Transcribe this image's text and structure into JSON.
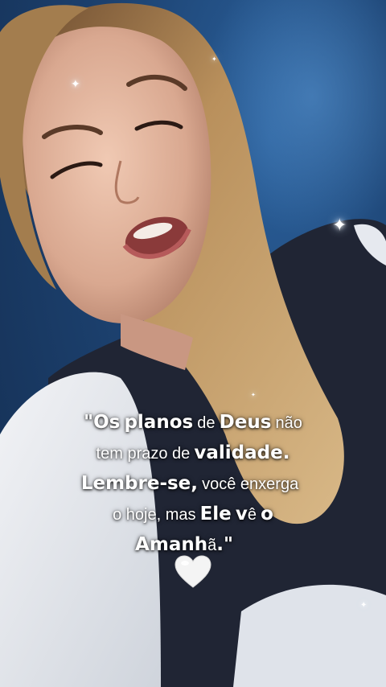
{
  "quote": {
    "line1": {
      "w1": "\"Os",
      "w2": "planos",
      "w3": "de",
      "w4": "Deus",
      "w5": "não"
    },
    "line2": {
      "w1": "tem prazo de",
      "w2": "validade."
    },
    "line3": {
      "w1": "Lembre-se,",
      "w2": "você enxerga"
    },
    "line4": {
      "w1": "o hoje, mas",
      "w2": "Ele",
      "w3": "v",
      "w4": "ê",
      "w5": "o"
    },
    "line5": {
      "w1": "Amanh",
      "w2": "ã",
      "w3": ".\""
    }
  },
  "decorations": {
    "heart_icon": "white-heart-icon",
    "sparkle_icon": "sparkle-icon"
  },
  "colors": {
    "background": "#1c416f",
    "text": "#ffffff",
    "hair": "#c49a63"
  }
}
